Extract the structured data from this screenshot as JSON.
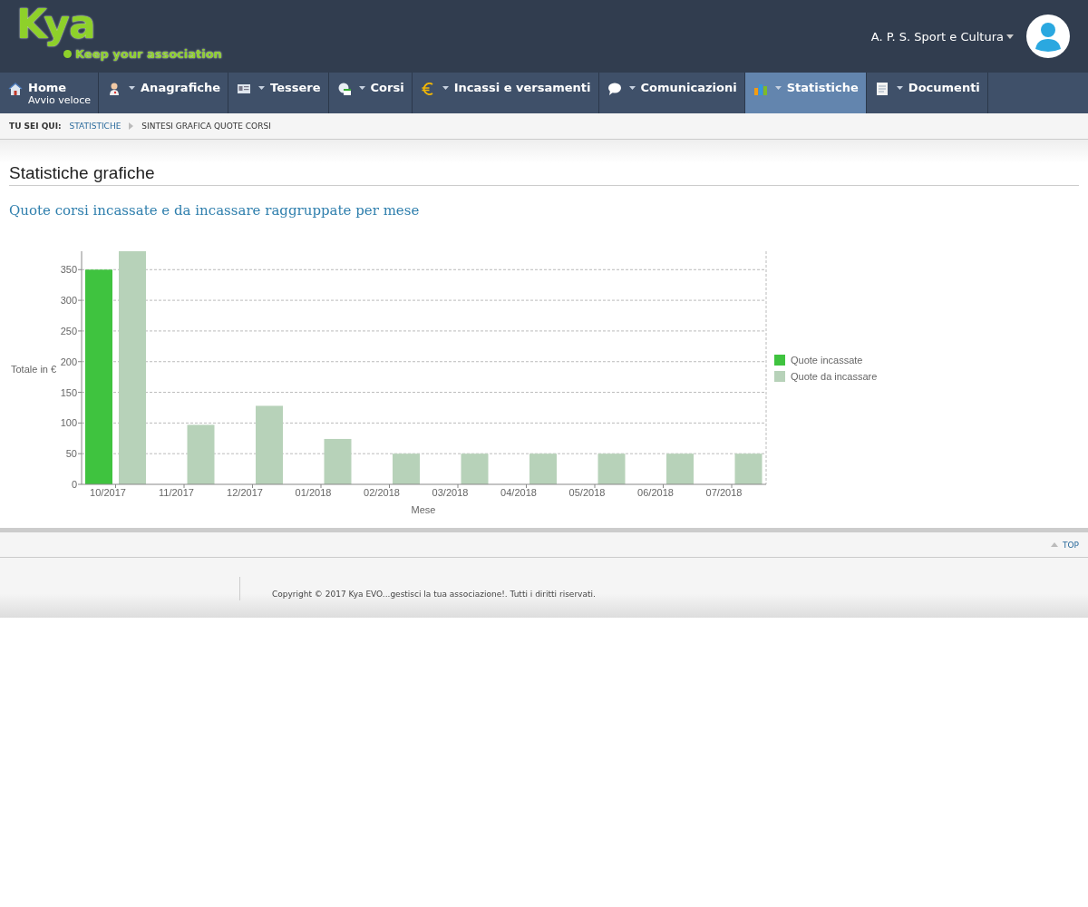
{
  "logo": {
    "title": "Kya",
    "tagline": "Keep your association"
  },
  "user": {
    "name": "A. P. S. Sport e Cultura"
  },
  "nav": [
    {
      "label": "Home",
      "sublabel": "Avvio veloce",
      "dropdown": false,
      "selected": false
    },
    {
      "label": "Anagrafiche",
      "dropdown": true,
      "selected": false
    },
    {
      "label": "Tessere",
      "dropdown": true,
      "selected": false
    },
    {
      "label": "Corsi",
      "dropdown": true,
      "selected": false
    },
    {
      "label": "Incassi e versamenti",
      "dropdown": true,
      "selected": false
    },
    {
      "label": "Comunicazioni",
      "dropdown": true,
      "selected": false
    },
    {
      "label": "Statistiche",
      "dropdown": true,
      "selected": true
    },
    {
      "label": "Documenti",
      "dropdown": true,
      "selected": false
    }
  ],
  "breadcrumb": {
    "label": "TU SEI QUI:",
    "items": [
      "STATISTICHE",
      "SINTESI GRAFICA QUOTE CORSI"
    ]
  },
  "page": {
    "title": "Statistiche grafiche",
    "subtitle": "Quote corsi incassate e da incassare raggruppate per mese"
  },
  "chart_data": {
    "type": "bar",
    "xlabel": "Mese",
    "ylabel": "Totale in €",
    "categories": [
      "10/2017",
      "11/2017",
      "12/2017",
      "01/2018",
      "02/2018",
      "03/2018",
      "04/2018",
      "05/2018",
      "06/2018",
      "07/2018"
    ],
    "series": [
      {
        "name": "Quote incassate",
        "color": "#3fc33f",
        "values": [
          350,
          null,
          null,
          null,
          null,
          null,
          null,
          null,
          null,
          null
        ]
      },
      {
        "name": "Quote da incassare",
        "color": "#b7d2b9",
        "values": [
          380,
          97,
          128,
          74,
          50,
          50,
          50,
          50,
          50,
          50
        ]
      }
    ],
    "ylim": [
      0,
      380
    ],
    "grid": true,
    "legend": true,
    "yticks": [
      0,
      50,
      100,
      150,
      200,
      250,
      300,
      350
    ]
  },
  "footer": {
    "top": "TOP",
    "copyright": "Copyright © 2017 Kya EVO...gestisci la tua associazione!. Tutti i diritti riservati."
  }
}
